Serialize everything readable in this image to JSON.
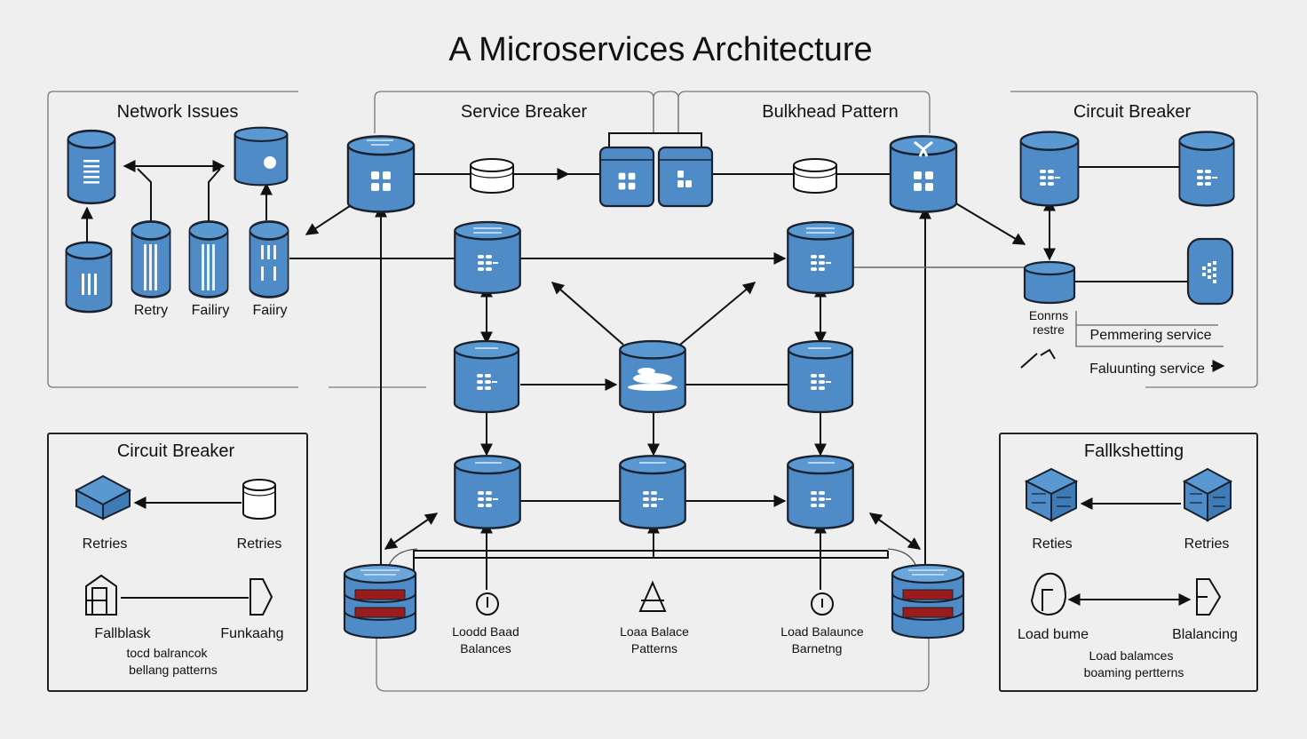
{
  "title": "A Microservices Architecture",
  "colors": {
    "service_fill": "#4f8cc7",
    "service_stroke": "#1a2230",
    "background": "#efefef",
    "rack_red": "#9b1c1c",
    "line": "#111111"
  },
  "panels": {
    "network_issues": {
      "title": "Network Issues",
      "labels": [
        "Retry",
        "Failiry",
        "Faiiry"
      ]
    },
    "service_breaker": {
      "title": "Service Breaker"
    },
    "bulkhead_pattern": {
      "title": "Bulkhead Pattern"
    },
    "circuit_breaker_top": {
      "title": "Circuit Breaker",
      "node_label": [
        "Eonrns",
        "restre"
      ],
      "rows": [
        "Pemmering service",
        "Faluunting service"
      ]
    },
    "circuit_breaker_bottom": {
      "title": "Circuit Breaker",
      "top_labels": [
        "Retries",
        "Retries"
      ],
      "bottom_labels": [
        "Fallblask",
        "Funkaahg"
      ],
      "caption": [
        "tocd balrancok",
        "bellang patterns"
      ]
    },
    "fallkshetting": {
      "title": "Fallkshetting",
      "top_labels": [
        "Reties",
        "Retries"
      ],
      "bottom_labels": [
        "Load bume",
        "Blalancing"
      ],
      "caption": [
        "Load balamces",
        "boaming pertterns"
      ]
    },
    "load_balancers": [
      {
        "icon": "timer-icon",
        "lines": [
          "Loodd Baad",
          "Balances"
        ]
      },
      {
        "icon": "triangle-warning-icon",
        "lines": [
          "Loaa Balace",
          "Patterns"
        ]
      },
      {
        "icon": "info-icon",
        "lines": [
          "Load Balaunce",
          "Barnetng"
        ]
      }
    ]
  }
}
